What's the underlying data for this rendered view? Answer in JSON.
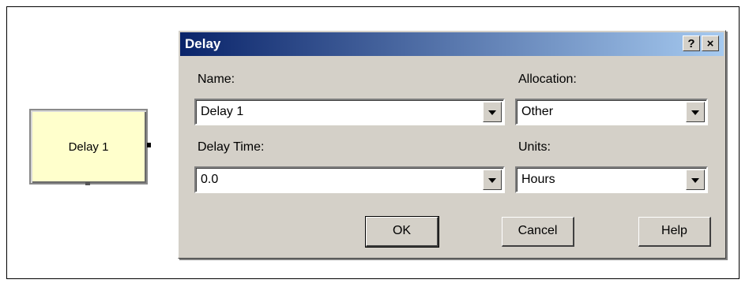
{
  "canvas": {
    "module_label": "Delay 1"
  },
  "dialog": {
    "title": "Delay",
    "help_button": "?",
    "close_button": "×",
    "name_label": "Name:",
    "name_value": "Delay 1",
    "allocation_label": "Allocation:",
    "allocation_value": "Other",
    "delay_time_label": "Delay Time:",
    "delay_time_value": "0.0",
    "units_label": "Units:",
    "units_value": "Hours",
    "ok_label": "OK",
    "cancel_label": "Cancel",
    "help_label": "Help"
  },
  "colors": {
    "title_bar_start": "#0a246a",
    "title_bar_end": "#a6caf0",
    "dialog_bg": "#d4d0c8",
    "module_fill": "#ffffcc"
  }
}
